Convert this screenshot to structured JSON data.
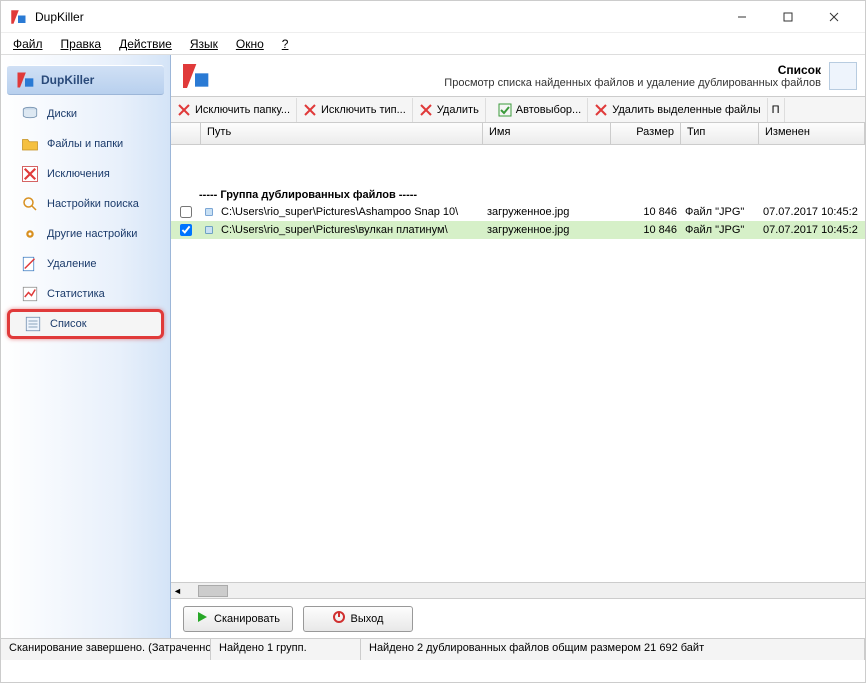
{
  "window": {
    "title": "DupKiller"
  },
  "menu": [
    "Файл",
    "Правка",
    "Действие",
    "Язык",
    "Окно",
    "?"
  ],
  "sidebar": {
    "header": "DupKiller",
    "items": [
      {
        "label": "Диски"
      },
      {
        "label": "Файлы и папки"
      },
      {
        "label": "Исключения"
      },
      {
        "label": "Настройки поиска"
      },
      {
        "label": "Другие настройки"
      },
      {
        "label": "Удаление"
      },
      {
        "label": "Статистика"
      },
      {
        "label": "Список"
      }
    ]
  },
  "page": {
    "title": "Список",
    "subtitle": "Просмотр списка найденных файлов и удаление дублированных файлов"
  },
  "toolbar": {
    "excl_folder": "Исключить папку...",
    "excl_type": "Исключить тип...",
    "delete": "Удалить",
    "autoselect": "Автовыбор...",
    "delete_selected": "Удалить выделенные файлы"
  },
  "columns": {
    "path": "Путь",
    "name": "Имя",
    "size": "Размер",
    "type": "Тип",
    "modified": "Изменен"
  },
  "group_label": "-----  Группа дублированных файлов  -----",
  "rows": [
    {
      "checked": false,
      "path": "C:\\Users\\rio_super\\Pictures\\Ashampoo Snap 10\\",
      "name": "загруженное.jpg",
      "size": "10 846",
      "type": "Файл \"JPG\"",
      "date": "07.07.2017 10:45:2"
    },
    {
      "checked": true,
      "path": "C:\\Users\\rio_super\\Pictures\\вулкан платинум\\",
      "name": "загруженное.jpg",
      "size": "10 846",
      "type": "Файл \"JPG\"",
      "date": "07.07.2017 10:45:2"
    }
  ],
  "buttons": {
    "scan": "Сканировать",
    "exit": "Выход"
  },
  "status": {
    "left": "Сканирование завершено. (Затраченное вре",
    "mid": "Найдено 1 групп.",
    "right": "Найдено 2 дублированных файлов общим размером 21 692 байт"
  }
}
